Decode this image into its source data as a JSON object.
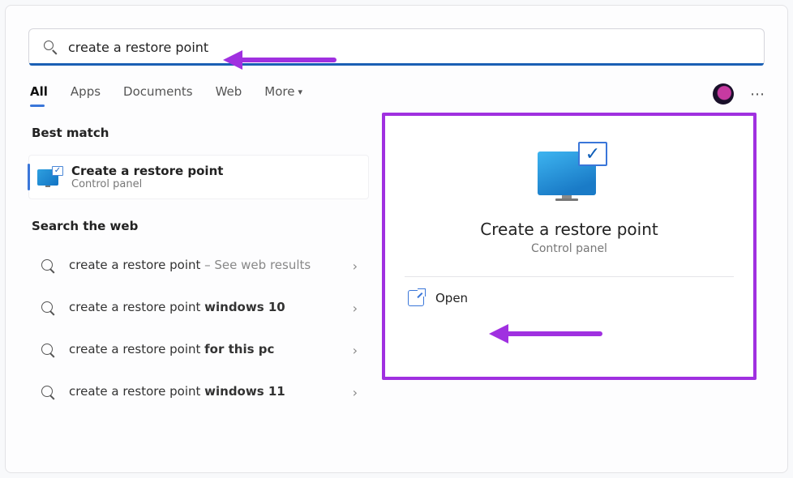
{
  "search": {
    "query": "create a restore point"
  },
  "tabs": {
    "all": "All",
    "apps": "Apps",
    "documents": "Documents",
    "web": "Web",
    "more": "More"
  },
  "sections": {
    "best_match": "Best match",
    "search_web": "Search the web"
  },
  "best_match": {
    "title": "Create a restore point",
    "subtitle": "Control panel"
  },
  "web_results": [
    {
      "prefix": "create a restore point",
      "suffix": " – See web results",
      "suffix_style": "light"
    },
    {
      "prefix": "create a restore point ",
      "suffix": "windows 10",
      "suffix_style": "bold"
    },
    {
      "prefix": "create a restore point ",
      "suffix": "for this pc",
      "suffix_style": "bold"
    },
    {
      "prefix": "create a restore point ",
      "suffix": "windows 11",
      "suffix_style": "bold"
    }
  ],
  "detail": {
    "title": "Create a restore point",
    "subtitle": "Control panel",
    "open": "Open"
  }
}
